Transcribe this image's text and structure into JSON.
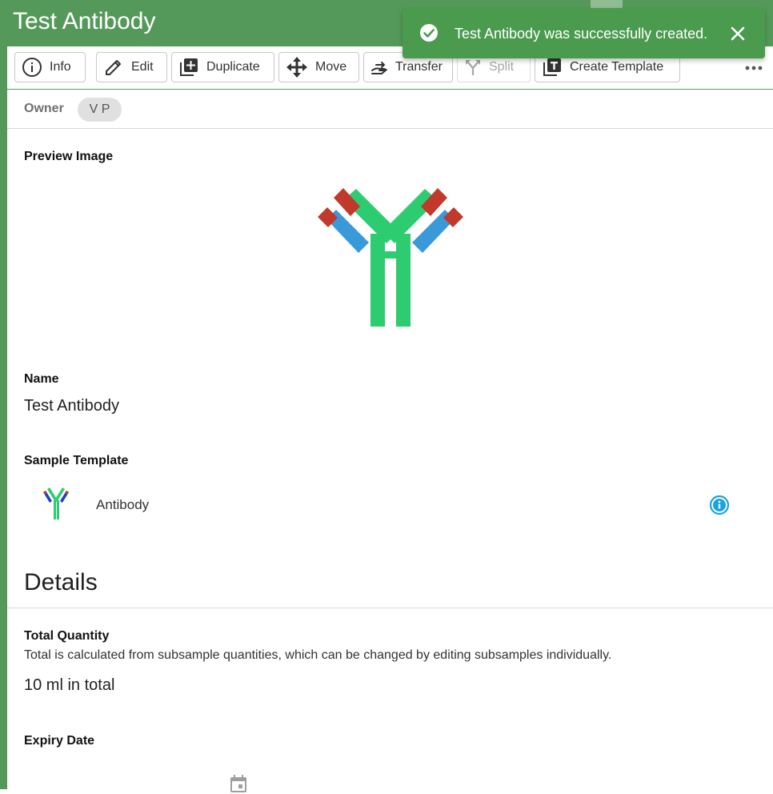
{
  "header": {
    "title": "Test Antibody"
  },
  "toolbar": {
    "info": "Info",
    "edit": "Edit",
    "duplicate": "Duplicate",
    "move": "Move",
    "transfer": "Transfer",
    "split": "Split",
    "create_template": "Create Template",
    "more_icon": "more-horizontal-icon"
  },
  "owner": {
    "label": "Owner",
    "initials": "V P"
  },
  "preview": {
    "label": "Preview Image",
    "icon": "antibody-icon"
  },
  "name": {
    "label": "Name",
    "value": "Test Antibody"
  },
  "sample_template": {
    "label": "Sample Template",
    "value": "Antibody",
    "icon": "antibody-icon"
  },
  "details": {
    "title": "Details",
    "total_quantity": {
      "label": "Total Quantity",
      "help": "Total is calculated from subsample quantities, which can be changed by editing subsamples individually.",
      "value": "10 ml in total"
    },
    "expiry_date": {
      "label": "Expiry Date"
    }
  },
  "toast": {
    "message": "Test Antibody was successfully created.",
    "icon": "check-circle-icon",
    "close_icon": "close-icon"
  },
  "colors": {
    "brand_green": "#55995a",
    "toast_green": "#4a9b4e",
    "antibody_green": "#2ecc71",
    "antibody_blue": "#3a9ad9",
    "antibody_red": "#c0392b",
    "info_blue": "#1aa3de"
  }
}
